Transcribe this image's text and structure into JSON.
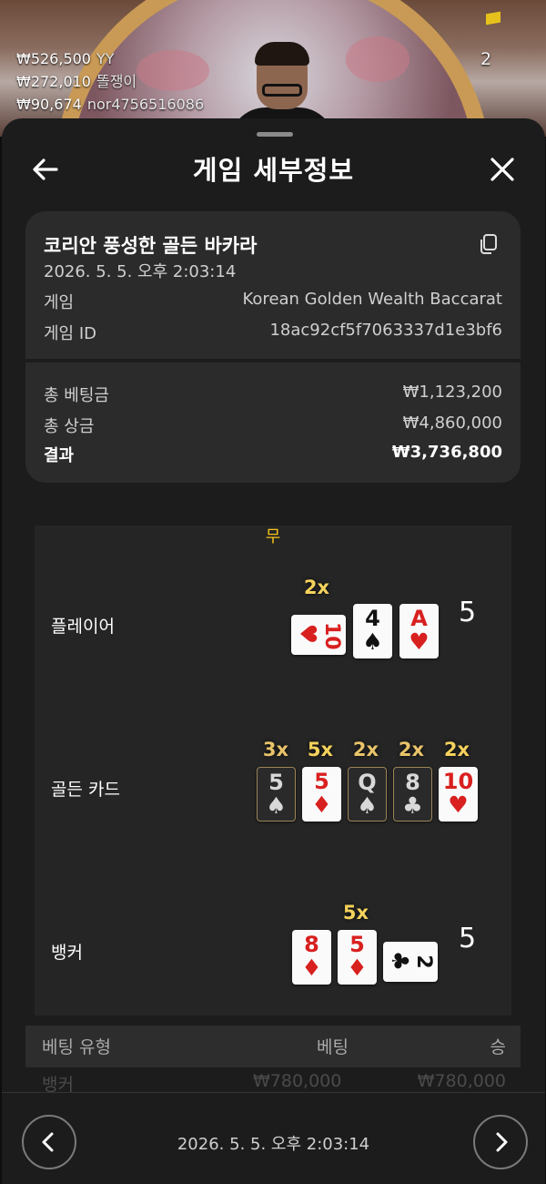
{
  "stream": {
    "viewers": "2",
    "winners": [
      {
        "amount": "₩526,500",
        "name": "YY"
      },
      {
        "amount": "₩272,010",
        "name": "똘쟁이"
      },
      {
        "amount": "₩90,674",
        "name": "nor4756516086"
      }
    ]
  },
  "header": {
    "title": "게임 세부정보",
    "back_icon": "arrow-left-icon",
    "close_icon": "close-icon"
  },
  "game": {
    "name": "코리안 풍성한 골든 바카라",
    "datetime": "2026. 5. 5. 오후 2:03:14",
    "game_label": "게임",
    "game_value": "Korean Golden Wealth Baccarat",
    "id_label": "게임 ID",
    "id_value": "18ac92cf5f7063337d1e3bf6"
  },
  "summary": {
    "total_bet_label": "총 베팅금",
    "total_bet": "₩1,123,200",
    "total_win_label": "총 상금",
    "total_win": "₩4,860,000",
    "result_label": "결과",
    "result": "₩3,736,800"
  },
  "board": {
    "tie_label": "무",
    "player": {
      "label": "플레이어",
      "score": "5",
      "multiplier": "2x",
      "cards": [
        {
          "rank": "10",
          "suit": "♥"
        },
        {
          "rank": "4",
          "suit": "♠"
        },
        {
          "rank": "A",
          "suit": "♥"
        }
      ]
    },
    "golden": {
      "label": "골든 카드",
      "multipliers": [
        "3x",
        "5x",
        "2x",
        "2x",
        "2x"
      ],
      "cards": [
        {
          "rank": "5",
          "suit": "♠"
        },
        {
          "rank": "5",
          "suit": "♦"
        },
        {
          "rank": "Q",
          "suit": "♠"
        },
        {
          "rank": "8",
          "suit": "♣"
        },
        {
          "rank": "10",
          "suit": "♥"
        }
      ]
    },
    "banker": {
      "label": "뱅커",
      "score": "5",
      "multiplier": "5x",
      "cards": [
        {
          "rank": "8",
          "suit": "♦"
        },
        {
          "rank": "5",
          "suit": "♦"
        },
        {
          "rank": "2",
          "suit": "♣"
        }
      ]
    }
  },
  "bets": {
    "headers": [
      "베팅 유형",
      "베팅",
      "승"
    ],
    "rows": [
      {
        "type": "뱅커",
        "bet": "₩780,000",
        "win": "₩780,000"
      }
    ]
  },
  "footer": {
    "datetime": "2026. 5. 5. 오후 2:03:14",
    "prev_icon": "chevron-left-icon",
    "next_icon": "chevron-right-icon"
  }
}
